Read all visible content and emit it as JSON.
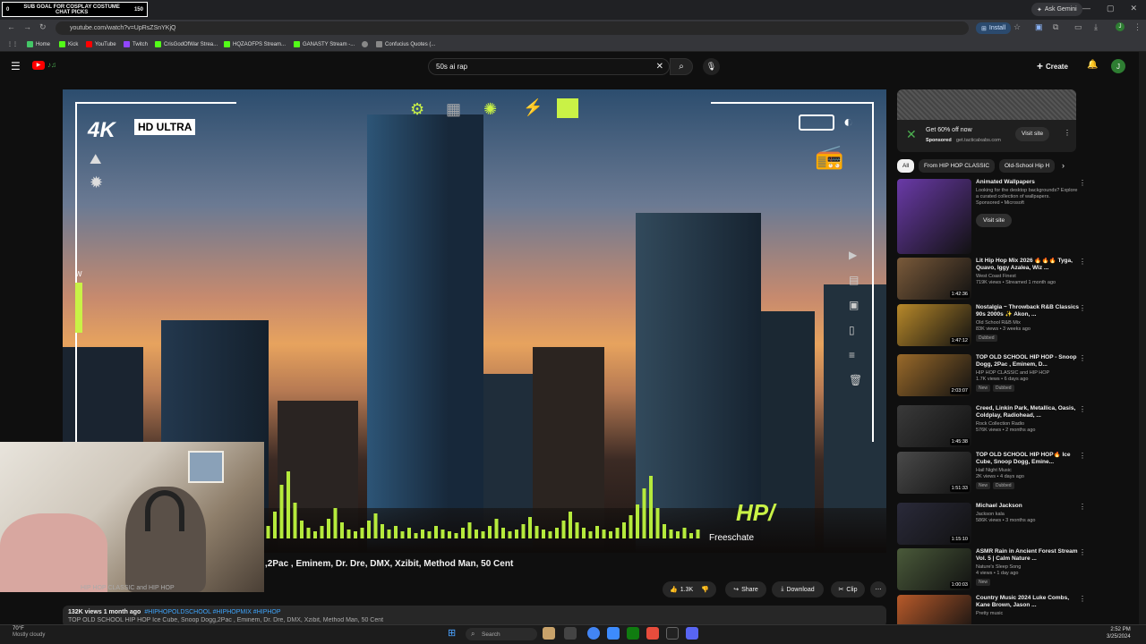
{
  "stream_overlay": {
    "count_left": "0",
    "goal_line1": "SUB GOAL FOR COSPLAY COSTUME",
    "goal_line2": "CHAT PICKS",
    "count_right": "150"
  },
  "browser": {
    "ask_gemini": "Ask Gemini",
    "url": "youtube.com/watch?v=UpRsZSnYKjQ",
    "install": "Install",
    "bookmarks": [
      {
        "label": "Home",
        "color": "#44c767"
      },
      {
        "label": "Kick",
        "color": "#53fc18"
      },
      {
        "label": "YouTube",
        "color": "#ff0000"
      },
      {
        "label": "Twitch",
        "color": "#9146ff"
      },
      {
        "label": "CrisGodOfWar Strea...",
        "color": "#53fc18"
      },
      {
        "label": "HQZAOFPS Stream...",
        "color": "#53fc18"
      },
      {
        "label": "GANASTY Stream -...",
        "color": "#53fc18"
      },
      {
        "label": "",
        "color": "#888888"
      },
      {
        "label": "Confucius Quotes (...",
        "color": "#888888"
      }
    ]
  },
  "youtube": {
    "search_query": "50s ai rap",
    "create": "Create",
    "avatar_letter": "J"
  },
  "player": {
    "badge_4k": "4K",
    "badge_hd": "HD ULTRA",
    "hp_logo": "HP/",
    "watermark": "Freeschate",
    "volume_label": "W"
  },
  "video": {
    "title_visible": ",2Pac , Eminem, Dr. Dre, DMX, Xzibit, Method Man, 50 Cent",
    "channel": "HIP HOP CLASSIC and HIP HOP",
    "like_count": "1.3K",
    "share": "Share",
    "download": "Download",
    "clip": "Clip",
    "views_date": "132K views  1 month ago",
    "hashtags": "#HIPHOPOLDSCHOOL #HIPHOPMIX #HIPHOP",
    "desc_line2": "TOP OLD SCHOOL HIP HOP Ice Cube, Snoop Dogg,2Pac , Eminem, Dr. Dre, DMX, Xzibit, Method Man, 50 Cent"
  },
  "sidebar_ad": {
    "headline": "Get 60% off now",
    "sponsored": "Sponsored",
    "domain": "get.tacticalxabs.com",
    "cta": "Visit site"
  },
  "chips": [
    "All",
    "From HIP HOP CLASSIC",
    "Old-School Hip H"
  ],
  "recommendations": [
    {
      "title": "Animated Wallpapers",
      "channel": "Looking for the desktop backgrounds? Explore a curated collection of wallpapers.",
      "meta": "Sponsored • Microsoft",
      "duration": "",
      "tags": [],
      "cta": "Visit site",
      "thumb": "#6a3aa8"
    },
    {
      "title": "Lit Hip Hop Mix 2026 🔥🔥🔥 Tyga, Quavo, Iggy Azalea, Wiz ...",
      "channel": "West Coast Finest",
      "meta": "719K views • Streamed 1 month ago",
      "duration": "1:42:36",
      "tags": [],
      "thumb": "#7a5a3a"
    },
    {
      "title": "Nostalgia ~ Throwback R&B Classics 90s 2000s ✨ Akon, ...",
      "channel": "Old School R&B Mix",
      "meta": "83K views • 3 weeks ago",
      "duration": "1:47:12",
      "tags": [
        "Dubbed"
      ],
      "thumb": "#b8892a"
    },
    {
      "title": "TOP OLD SCHOOL HIP HOP - Snoop Dogg, 2Pac , Eminem, D...",
      "channel": "HIP HOP CLASSIC and HIP HOP",
      "meta": "1.7K views • 6 days ago",
      "duration": "2:03:07",
      "tags": [
        "New",
        "Dubbed"
      ],
      "thumb": "#9a6a2a"
    },
    {
      "title": "Creed, Linkin Park, Metallica, Oasis, Coldplay, Radiohead, ...",
      "channel": "Rock Collection Radio",
      "meta": "576K views • 2 months ago",
      "duration": "1:45:38",
      "tags": [],
      "thumb": "#3a3a3a"
    },
    {
      "title": "TOP OLD SCHOOL HIP HOP🔥 Ice Cube, Snoop Dogg, Emine...",
      "channel": "Hail Night Music",
      "meta": "2K views • 4 days ago",
      "duration": "1:51:33",
      "tags": [
        "New",
        "Dubbed"
      ],
      "thumb": "#4a4a4a"
    },
    {
      "title": "Michael Jackson",
      "channel": "Jackson kala",
      "meta": "586K views • 3 months ago",
      "duration": "1:15:10",
      "tags": [],
      "thumb": "#2a2a3a"
    },
    {
      "title": "ASMR Rain in Ancient Forest Stream Vol. 5 | Calm Nature ...",
      "channel": "Nature's Sleep Song",
      "meta": "4 views • 1 day ago",
      "duration": "1:00:03",
      "tags": [
        "New"
      ],
      "thumb": "#4a5a3a"
    },
    {
      "title": "Country Music 2024 Luke Combs, Kane Brown, Jason ...",
      "channel": "Pretty music",
      "meta": "",
      "duration": "",
      "tags": [],
      "thumb": "#b85a2a"
    }
  ],
  "taskbar": {
    "weather_temp": "70°F",
    "weather_desc": "Mostly cloudy",
    "search": "Search",
    "time": "2:52 PM",
    "date": "3/25/2024"
  }
}
